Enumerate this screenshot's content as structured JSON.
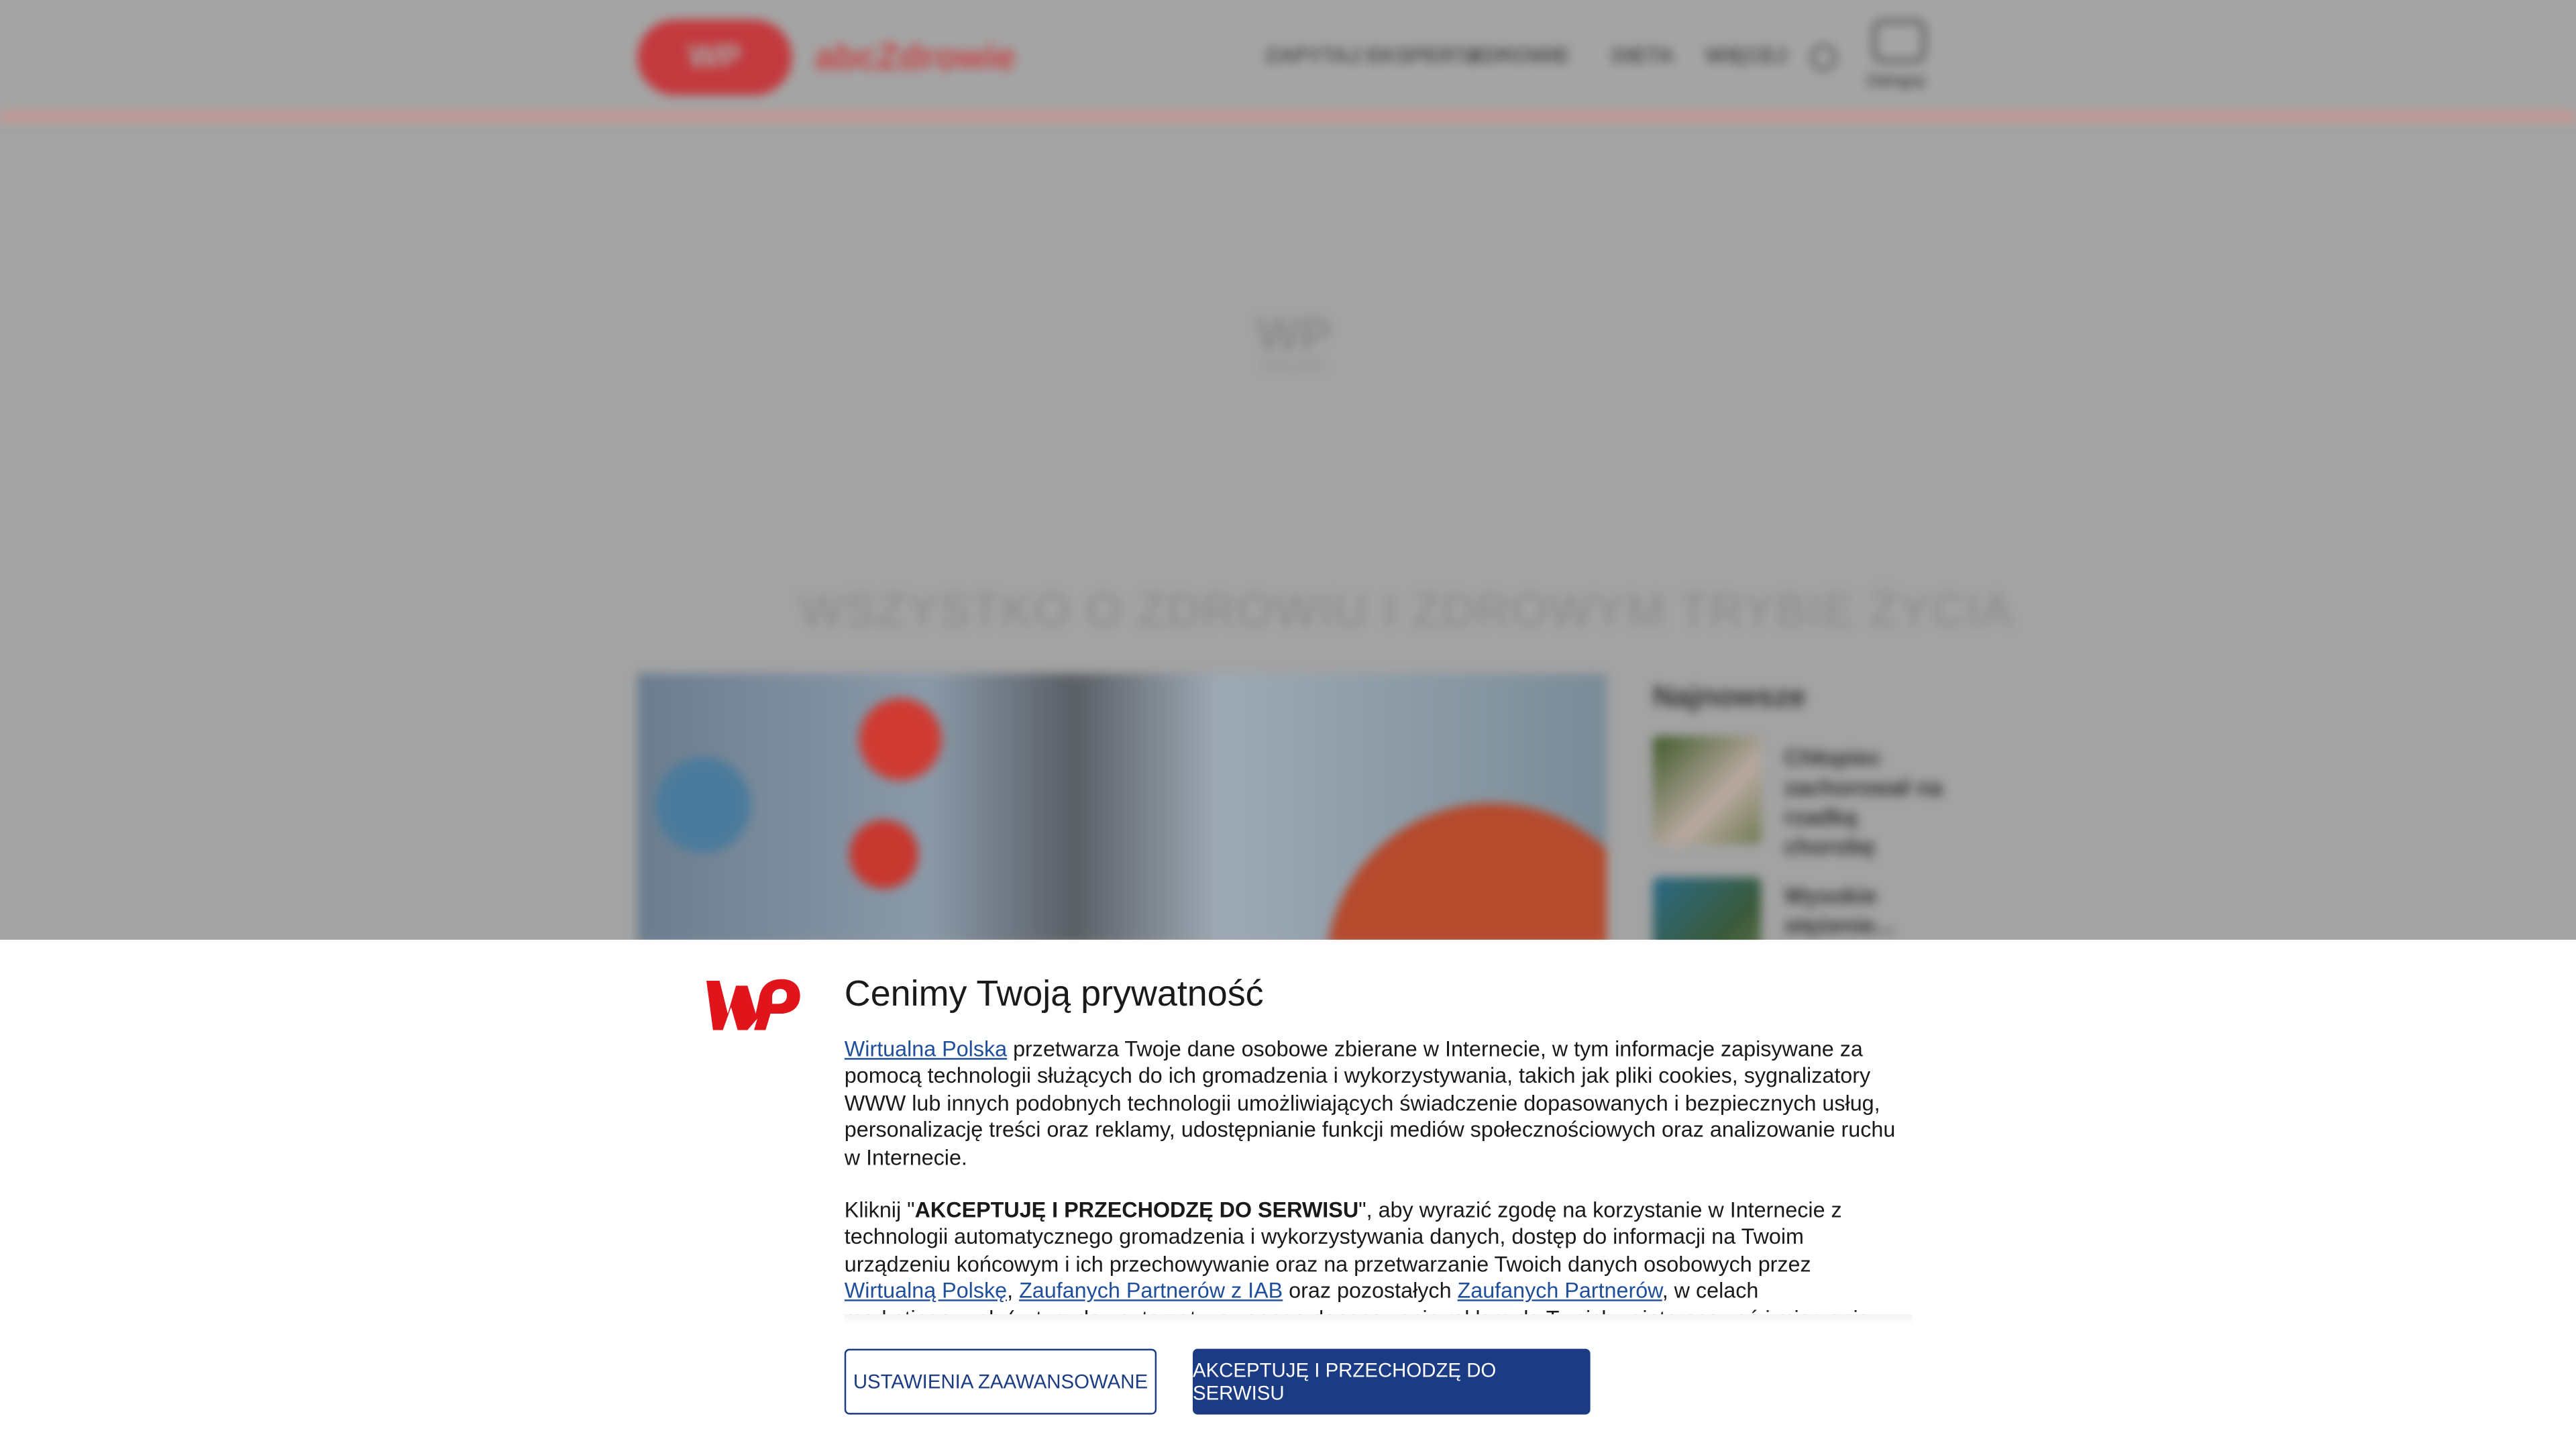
{
  "header": {
    "logo": "WP",
    "site_name": "abcZdrowie",
    "nav": [
      "ZAPYTAJ EKSPERTA",
      "ZDROWIE",
      "DIETA",
      "WIĘCEJ"
    ],
    "account_label": "Zaloguj"
  },
  "ad": {
    "logo": "WP",
    "label": "REKLAMA"
  },
  "main": {
    "headline": "WSZYSTKO O ZDROWIU I ZDROWYM TRYBIE ŻYCIA",
    "sidebar_title": "Najnowsze",
    "sidebar_items": [
      "Chłopiec zachorował na rzadką chorobę",
      "Wysokie stężenie..."
    ]
  },
  "consent": {
    "title": "Cenimy Twoją prywatność",
    "p1_link": "Wirtualna Polska",
    "p1_text": " przetwarza Twoje dane osobowe zbierane w Internecie, w tym informacje zapisywane za pomocą technologii służących do ich gromadzenia i wykorzystywania, takich jak pliki cookies, sygnalizatory WWW lub innych podobnych technologii umożliwiających świadczenie dopasowanych i bezpiecznych usług, personalizację treści oraz reklamy, udostępnianie funkcji mediów społecznościowych oraz analizowanie ruchu w Internecie.",
    "p2_a": "Kliknij \"",
    "p2_bold": "AKCEPTUJĘ I PRZECHODZĘ DO SERWISU",
    "p2_b": "\", aby wyrazić zgodę na korzystanie w Internecie z technologii automatycznego gromadzenia i wykorzystywania danych, dostęp do informacji na Twoim urządzeniu końcowym i ich przechowywanie oraz na przetwarzanie Twoich danych osobowych przez ",
    "p2_link1": "Wirtualną Polskę",
    "p2_sep": ", ",
    "p2_link2": "Zaufanych Partnerów z IAB",
    "p2_c": " oraz pozostałych ",
    "p2_link3": "Zaufanych Partnerów",
    "p2_d": ", w celach marketingowych (w tym do zautomatyzowanego dopasowania reklam do Twoich zainteresowań i mierzenia ich skuteczności) i pozostałych.",
    "btn_advanced": "USTAWIENIA ZAAWANSOWANE",
    "btn_accept": "AKCEPTUJĘ I PRZECHODZĘ DO SERWISU",
    "brand_color": "#e1141b",
    "button_color": "#1b3b84"
  }
}
